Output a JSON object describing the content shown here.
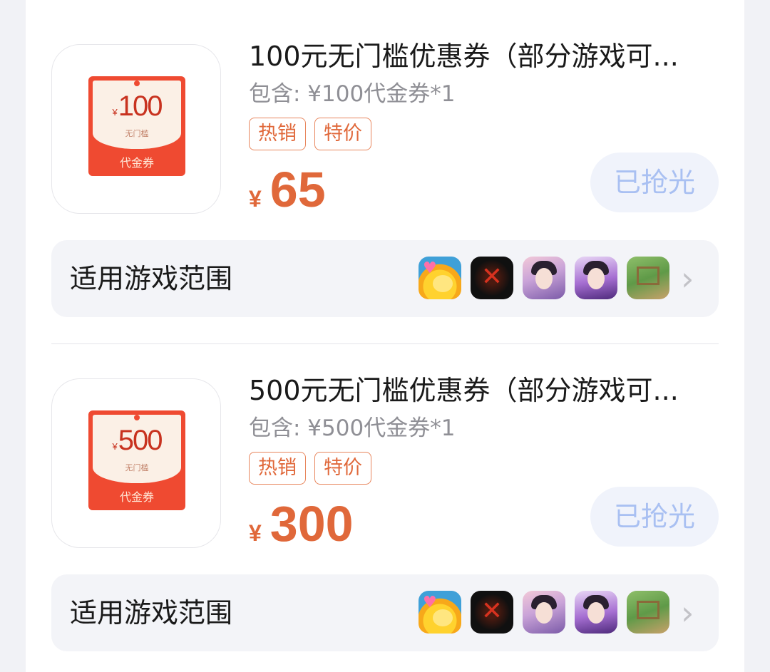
{
  "offers": [
    {
      "coupon": {
        "amount": "100",
        "currency": "¥",
        "sub": "无门槛",
        "label": "代金券"
      },
      "title": "100元无门槛优惠券（部分游戏可...",
      "contains": "包含: ¥100代金券*1",
      "tags": [
        "热销",
        "特价"
      ],
      "price": {
        "currency": "¥",
        "value": "65"
      },
      "button": "已抢光",
      "scope_label": "适用游戏范围"
    },
    {
      "coupon": {
        "amount": "500",
        "currency": "¥",
        "sub": "无门槛",
        "label": "代金券"
      },
      "title": "500元无门槛优惠券（部分游戏可...",
      "contains": "包含: ¥500代金券*1",
      "tags": [
        "热销",
        "特价"
      ],
      "price": {
        "currency": "¥",
        "value": "300"
      },
      "button": "已抢光",
      "scope_label": "适用游戏范围"
    }
  ],
  "game_icons": [
    "chick-game-icon",
    "red-glyph-game-icon",
    "heroine-game-icon",
    "purple-heroine-game-icon",
    "farm-game-icon"
  ],
  "chevron": "›",
  "colors": {
    "accent": "#e0683a",
    "coupon_red": "#ef4a31",
    "soldout_text": "#a9c0f2",
    "soldout_bg": "#f0f3fb"
  }
}
